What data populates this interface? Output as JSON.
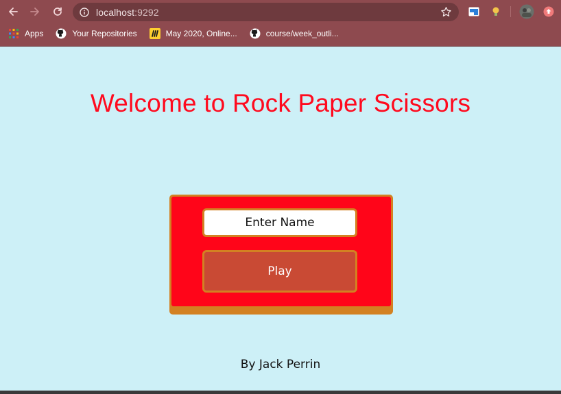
{
  "browser": {
    "url_host": "localhost",
    "url_port": ":9292",
    "bookmarks": [
      {
        "label": "Apps",
        "icon": "apps-grid-icon"
      },
      {
        "label": "Your Repositories",
        "icon": "github-icon"
      },
      {
        "label": "May 2020, Online...",
        "icon": "miro-icon"
      },
      {
        "label": "course/week_outli...",
        "icon": "github-icon"
      }
    ]
  },
  "page": {
    "title": "Welcome to Rock Paper Scissors",
    "form": {
      "name_placeholder": "Enter Name",
      "play_label": "Play"
    },
    "credit": "By Jack Perrin"
  },
  "colors": {
    "background": "#cdf0f7",
    "title": "#ff0a1e",
    "card": "#ff0519",
    "card_border": "#d38122",
    "play_button": "#c94a34"
  }
}
